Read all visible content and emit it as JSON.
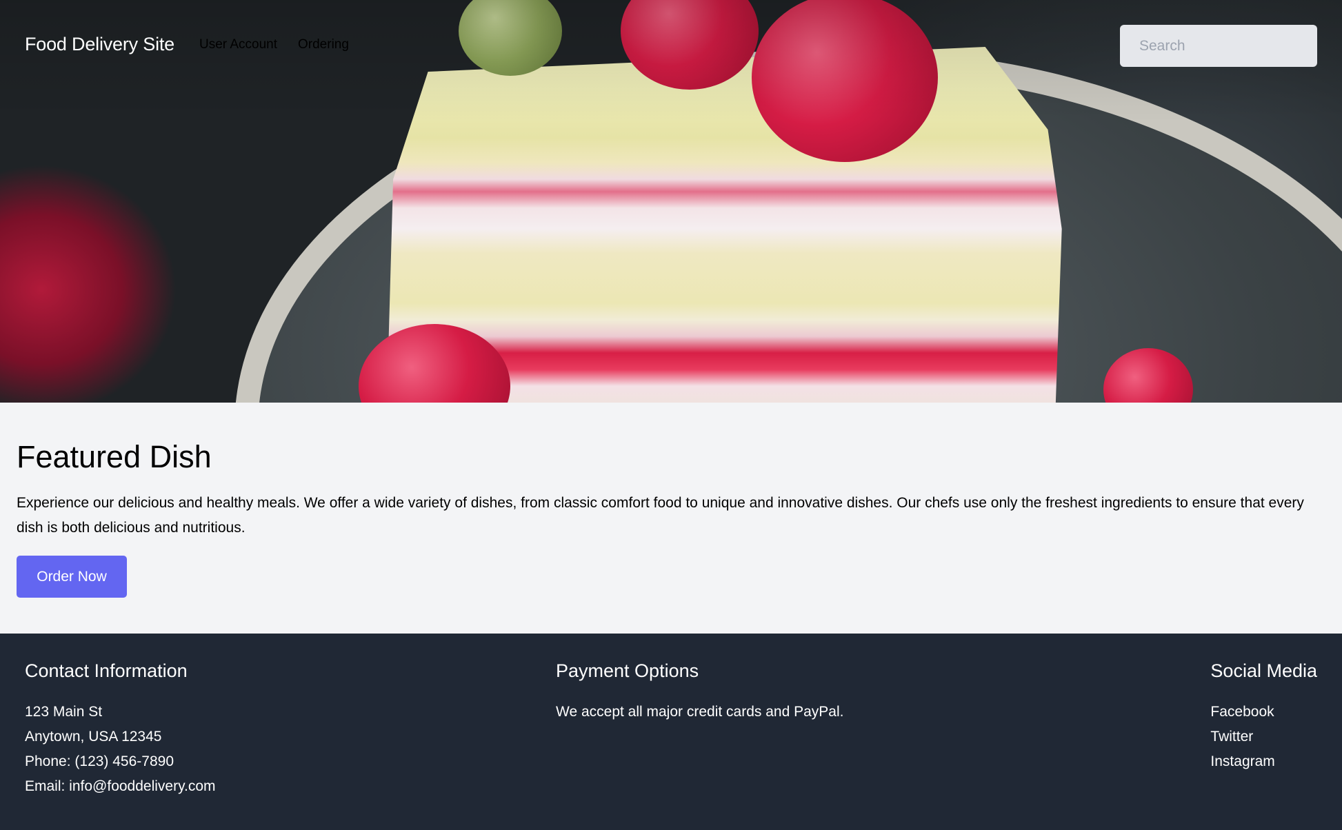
{
  "header": {
    "brand": "Food Delivery Site",
    "nav_links": [
      {
        "label": "User Account"
      },
      {
        "label": "Ordering"
      }
    ],
    "search": {
      "placeholder": "Search",
      "value": ""
    }
  },
  "hero": {
    "image": "raspberry-pistachio-cake-slice-photo"
  },
  "featured": {
    "title": "Featured Dish",
    "description": "Experience our delicious and healthy meals. We offer a wide variety of dishes, from classic comfort food to unique and innovative dishes. Our chefs use only the freshest ingredients to ensure that every dish is both delicious and nutritious.",
    "cta_label": "Order Now",
    "cta_color": "#6366f1"
  },
  "footer": {
    "background": "#202835",
    "contact": {
      "title": "Contact Information",
      "lines": [
        "123 Main St",
        "Anytown, USA 12345",
        "Phone: (123) 456-7890",
        "Email: info@fooddelivery.com"
      ]
    },
    "payment": {
      "title": "Payment Options",
      "text": "We accept all major credit cards and PayPal."
    },
    "social": {
      "title": "Social Media",
      "links": [
        {
          "label": "Facebook"
        },
        {
          "label": "Twitter"
        },
        {
          "label": "Instagram"
        }
      ]
    }
  }
}
